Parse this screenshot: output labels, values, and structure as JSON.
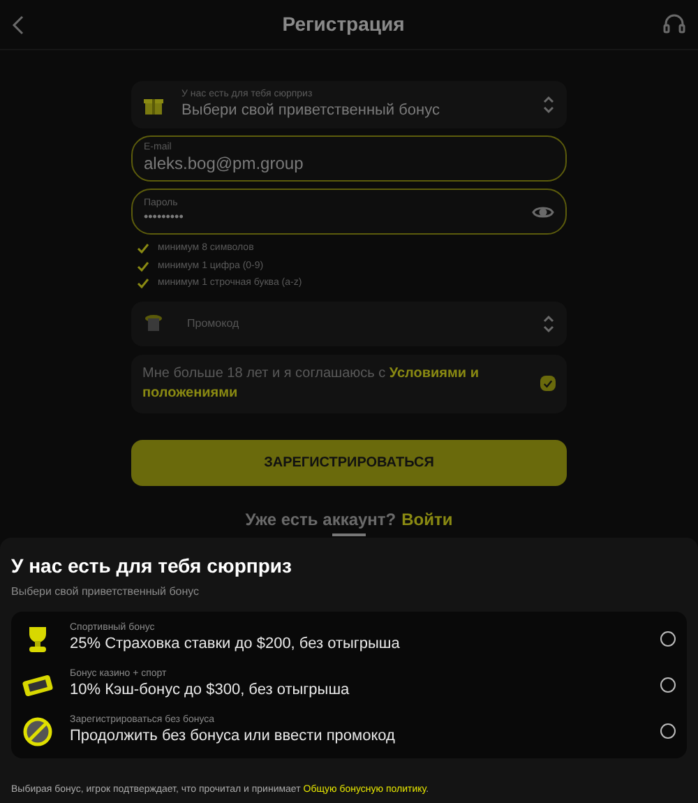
{
  "header": {
    "title": "Регистрация"
  },
  "form": {
    "bonus_select": {
      "label": "У нас есть для тебя сюрприз",
      "value": "Выбери свой приветственный бонус"
    },
    "email": {
      "label": "E-mail",
      "value": "aleks.bog@pm.group"
    },
    "password": {
      "label": "Пароль",
      "value": "•••••••••"
    },
    "rules": [
      {
        "text": "минимум 8 символов",
        "checked": true
      },
      {
        "text": "минимум 1 цифра (0-9)",
        "checked": true
      },
      {
        "text": "минимум 1 строчная буква (a-z)",
        "checked": true
      }
    ],
    "promo": {
      "placeholder": "Промокод"
    },
    "terms": {
      "text": "Мне больше 18 лет и я соглашаюсь с ",
      "link": "Условиями и положениями",
      "checked": true
    },
    "submit": "ЗАРЕГИСТРИРОВАТЬСЯ",
    "login": {
      "text": "Уже есть аккаунт?",
      "link": "Войти"
    }
  },
  "sheet": {
    "title": "У нас есть для тебя сюрприз",
    "subtitle": "Выбери свой приветственный бонус",
    "options": [
      {
        "kind": "trophy",
        "label": "Спортивный бонус",
        "value": "25% Страховка ставки до $200, без отыгрыша",
        "selected": false
      },
      {
        "kind": "slot",
        "label": "Бонус казино + спорт",
        "value": "10% Кэш-бонус до $300, без отыгрыша",
        "selected": false
      },
      {
        "kind": "none",
        "label": "Зарегистрироваться без бонуса",
        "value": "Продолжить без бонуса или ввести промокод",
        "selected": false
      }
    ],
    "footer": "Выбирая бонус, игрок подтверждает, что прочитал и принимает ",
    "footer_link": "Общую бонусную политику",
    "footer_end": "."
  }
}
